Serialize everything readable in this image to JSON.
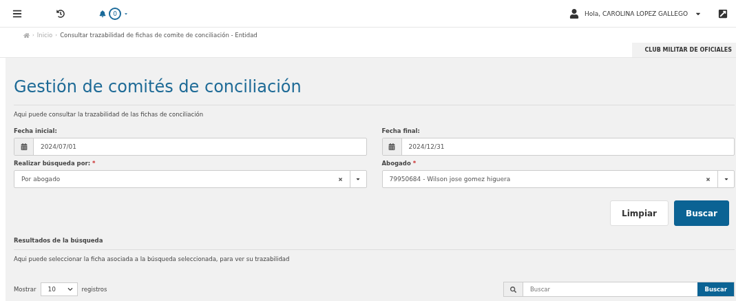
{
  "header": {
    "notification_count": "0",
    "user_greeting": "Hola, CAROLINA LOPEZ GALLEGO"
  },
  "breadcrumb": [
    {
      "separator": "›",
      "label": "Inicio",
      "link": true
    },
    {
      "separator": "›",
      "label": "Consultar trazabilidad de fichas de comite de conciliación - Entidad",
      "link": false
    }
  ],
  "entity_tab": "CLUB MILITAR DE OFICIALES",
  "title": "Gestión de comités de conciliación",
  "description": "Aqui puede consultar la trazabilidad de las fichas de conciliación",
  "fields": [
    {
      "kind": "date",
      "label": "Fecha inicial:",
      "value": "2024/07/01"
    },
    {
      "kind": "date",
      "label": "Fecha final:",
      "value": "2024/12/31"
    },
    {
      "kind": "select",
      "label": "Realizar búsqueda por:",
      "required_mark": "*",
      "value": "Por abogado"
    },
    {
      "kind": "select",
      "label": "Abogado",
      "required_mark": "*",
      "value": "79950684 - Wilson jose gomez higuera"
    }
  ],
  "buttons": [
    {
      "label": "Limpiar",
      "kind": "secondary"
    },
    {
      "label": "Buscar",
      "kind": "primary"
    }
  ],
  "results": {
    "title": "Resultados de la búsqueda",
    "description": "Aqui puede seleccionar la ficha asociada a la búsqueda seleccionada, para ver su trazabilidad",
    "show_label": "Mostrar",
    "page_size": "10",
    "records_label": "registros",
    "search_placeholder": "Buscar",
    "search_button": "Buscar"
  }
}
